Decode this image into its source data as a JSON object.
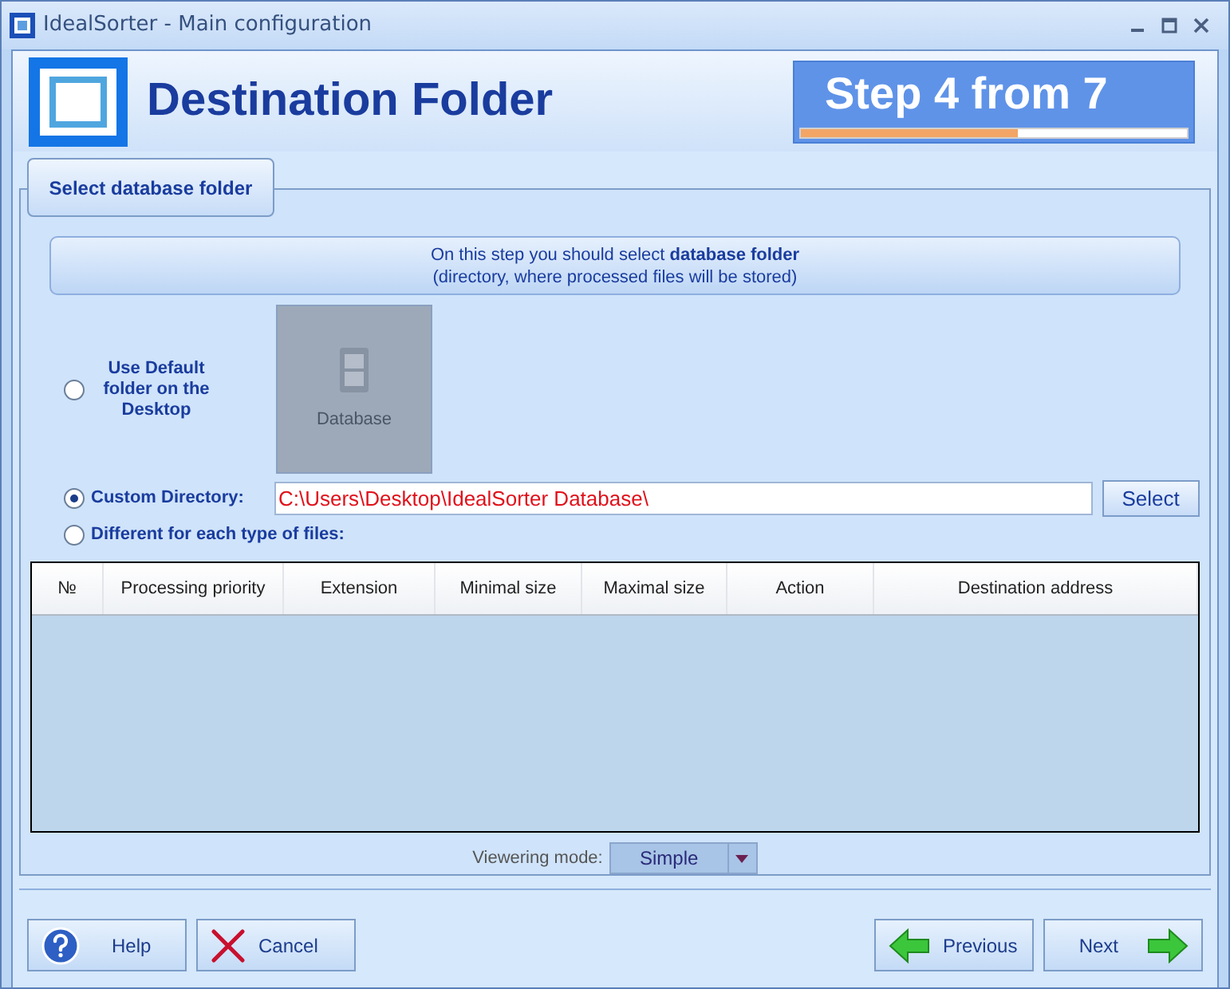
{
  "window": {
    "title": "IdealSorter - Main configuration"
  },
  "header": {
    "title": "Destination Folder",
    "step": "Step 4 from 7",
    "level": 0.56
  },
  "section_tab": "Select database folder",
  "info": {
    "line1": "On this step you should select **database folder**",
    "line2": "(directory, where processed files will be stored)"
  },
  "options": [
    {
      "label": "Use Default folder on the Desktop",
      "selected": false
    },
    {
      "label": "Custom Directory:",
      "selected": true
    },
    {
      "label": "Different for each type of files:",
      "selected": false
    }
  ],
  "default_tile": {
    "label": "Database",
    "disabled": true
  },
  "path": {
    "value": "C:\\Users\\Desktop\\IdealSorter Database\\"
  },
  "select_button": "Select",
  "table": {
    "columns": [
      "№",
      "Processing priority",
      "Extension",
      "Minimal size",
      "Maximal size",
      "Action",
      "Destination address"
    ]
  },
  "viewing_mode": {
    "label": "Viewering mode:",
    "value": "Simple"
  },
  "buttons": [
    {
      "label": "Help",
      "kind": "help"
    },
    {
      "label": "Cancel",
      "kind": "cancel"
    },
    {
      "label": "Previous",
      "kind": "previous"
    },
    {
      "label": "Next",
      "kind": "next"
    }
  ]
}
